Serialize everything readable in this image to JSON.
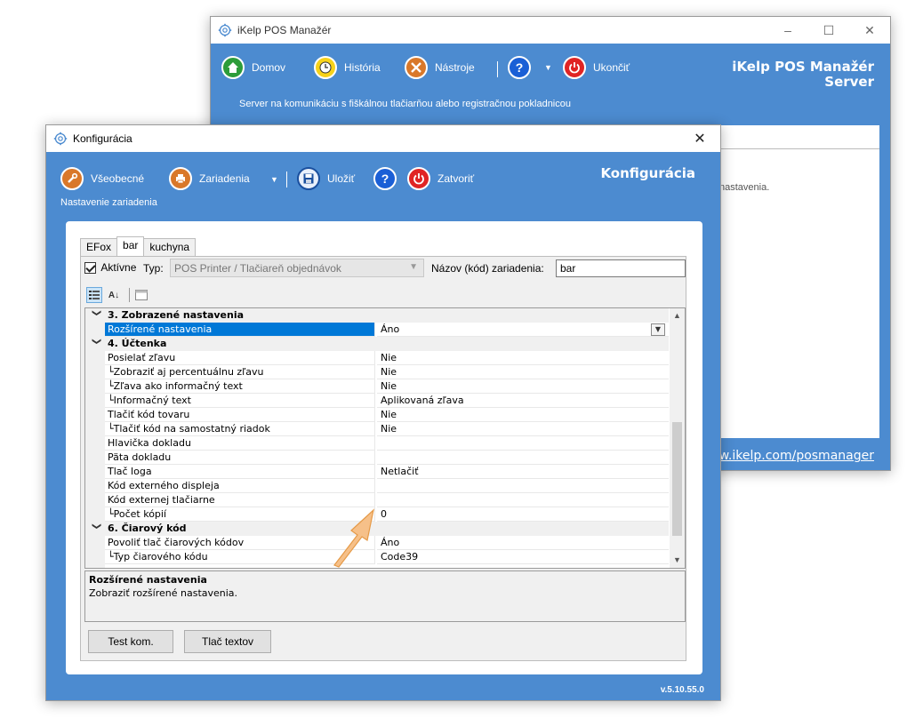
{
  "back_window": {
    "title": "iKelp POS Manažér",
    "toolbar": {
      "home": "Domov",
      "history": "História",
      "tools": "Nástroje",
      "exit": "Ukončiť"
    },
    "brand_line1": "iKelp POS Manažér",
    "brand_line2": "Server",
    "subtitle": "Server na komunikáciu s fiškálnou tlačiarňou alebo registračnou pokladnicou",
    "content_fragment": "nastavenia.",
    "link": "www.ikelp.com/posmanager"
  },
  "config_window": {
    "title": "Konfigurácia",
    "toolbar": {
      "general": "Všeobecné",
      "devices": "Zariadenia",
      "save": "Uložiť",
      "close": "Zatvoriť"
    },
    "brand": "Konfigurácia",
    "subtitle": "Nastavenie zariadenia",
    "tabs": [
      "EFox",
      "bar",
      "kuchyna"
    ],
    "active_label": "Aktívne",
    "type_label": "Typ:",
    "type_value": "POS Printer / Tlačiareň objednávok",
    "name_label": "Názov (kód) zariadenia:",
    "name_value": "bar",
    "grid": {
      "rows": [
        {
          "kind": "cat",
          "name": "3. Zobrazené nastavenia",
          "value": ""
        },
        {
          "kind": "sel",
          "name": "Rozšírené nastavenia",
          "value": "Áno"
        },
        {
          "kind": "cat",
          "name": "4. Účtenka",
          "value": ""
        },
        {
          "kind": "row",
          "name": "Posielať zľavu",
          "value": "Nie"
        },
        {
          "kind": "row",
          "name": "└Zobraziť aj percentuálnu zľavu",
          "value": "Nie"
        },
        {
          "kind": "row",
          "name": "└Zľava ako informačný text",
          "value": "Nie"
        },
        {
          "kind": "row",
          "name": "└Informačný text",
          "value": "Aplikovaná zľava"
        },
        {
          "kind": "row",
          "name": "Tlačiť kód tovaru",
          "value": "Nie"
        },
        {
          "kind": "row",
          "name": "└Tlačiť kód na samostatný riadok",
          "value": "Nie"
        },
        {
          "kind": "row",
          "name": "Hlavička dokladu",
          "value": ""
        },
        {
          "kind": "row",
          "name": "Päta dokladu",
          "value": ""
        },
        {
          "kind": "row",
          "name": "Tlač loga",
          "value": "Netlačiť"
        },
        {
          "kind": "row",
          "name": "Kód externého displeja",
          "value": ""
        },
        {
          "kind": "row",
          "name": "Kód externej tlačiarne",
          "value": ""
        },
        {
          "kind": "row",
          "name": "└Počet kópií",
          "value": "0"
        },
        {
          "kind": "cat",
          "name": "6. Čiarový kód",
          "value": ""
        },
        {
          "kind": "row",
          "name": "Povoliť tlač čiarových kódov",
          "value": "Áno"
        },
        {
          "kind": "row",
          "name": "└Typ čiarového kódu",
          "value": "Code39"
        }
      ]
    },
    "description_title": "Rozšírené nastavenia",
    "description_text": "Zobraziť rozšírené nastavenia.",
    "buttons": {
      "test": "Test kom.",
      "print_text": "Tlač textov"
    },
    "version": "v.5.10.55.0"
  },
  "colors": {
    "blue": "#4c8bd0",
    "selection": "#0078d7",
    "arrow": "#f6c089"
  }
}
